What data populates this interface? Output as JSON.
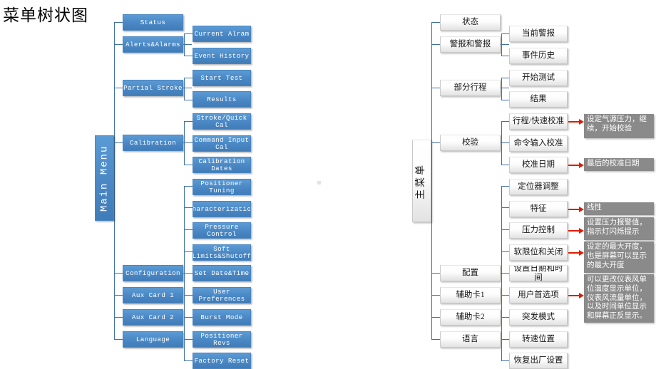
{
  "page": {
    "title": "菜单树状图",
    "accent_blue": "#5b9bd5",
    "accent_red": "#e01b00",
    "anno_grey": "#8a8a8a",
    "connector_blue": "#4472a8"
  },
  "left_tree": {
    "root": "Main Menu",
    "level1": [
      "Status",
      "Alerts&Alarms",
      "Partial Stroke",
      "Calibration",
      "Configuration",
      "Aux Card 1",
      "Aux Card 2",
      "Language"
    ],
    "level2": [
      "Current Alram",
      "Event History",
      "Start Test",
      "Results",
      "Stroke/Quick Cal",
      "Command Input Cal",
      "Calibration Dates",
      "Positioner Tuning",
      "Characterization",
      "Pressure Control",
      "Soft Limits&Shutoff",
      "Set Date&Time",
      "User Preferences",
      "Burst Mode",
      "Positioner Revs",
      "Factory Reset"
    ]
  },
  "right_tree": {
    "root": "主菜单",
    "level1": [
      "状态",
      "警报和警报",
      "部分行程",
      "校验",
      "配置",
      "辅助卡1",
      "辅助卡2",
      "语言"
    ],
    "level2": [
      "当前警报",
      "事件历史",
      "开始测试",
      "结果",
      "行程/快速校准",
      "命令输入校准",
      "校准日期",
      "定位器调整",
      "特征",
      "压力控制",
      "软限位和关闭",
      "设置日期和时间",
      "用户首选项",
      "突发模式",
      "转速位置",
      "恢复出厂设置"
    ]
  },
  "annotations": [
    {
      "id": "anno-stroke-quick-cal",
      "text": "设定气源压力，继续，开始校验"
    },
    {
      "id": "anno-calibration-date",
      "text": "最后的校准日期"
    },
    {
      "id": "anno-characteristic",
      "text": "线性"
    },
    {
      "id": "anno-pressure-control",
      "text": "设置压力报警值，指示灯闪烁提示"
    },
    {
      "id": "anno-soft-limits",
      "text": "设定的最大开度，也是屏幕可以显示的最大开度"
    },
    {
      "id": "anno-user-preferences",
      "text": "可以更改仪表风单位温度显示单位，仪表风流量单位，以及时间单位显示和屏幕正反显示。"
    }
  ]
}
